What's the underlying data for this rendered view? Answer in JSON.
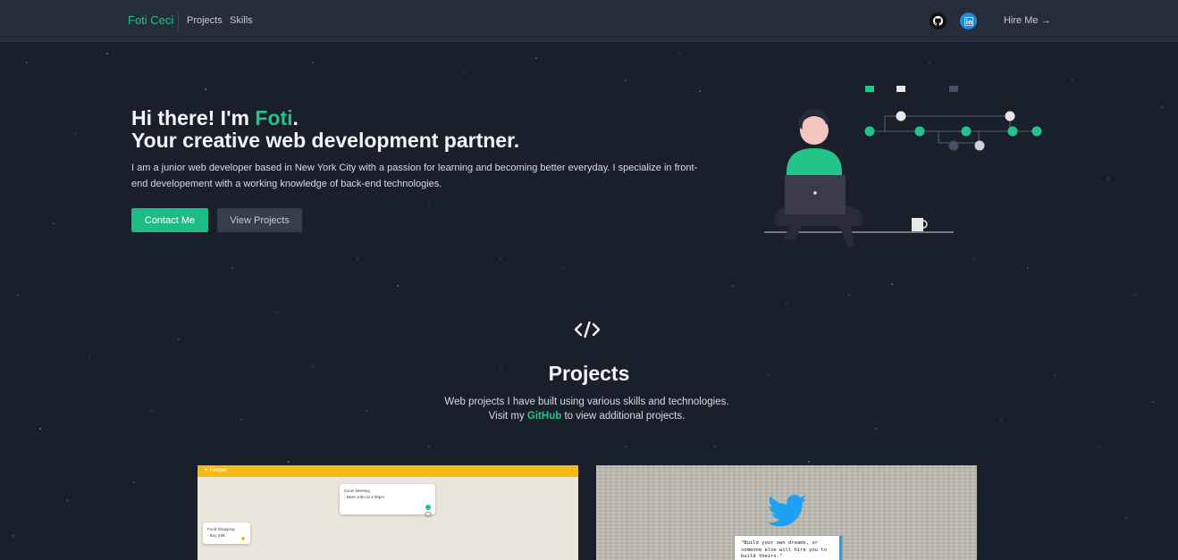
{
  "nav": {
    "brand": "Foti Ceci",
    "links": [
      "Projects",
      "Skills"
    ],
    "github_icon": "github-icon",
    "linkedin_icon": "linkedin-icon",
    "hire_label": "Hire Me",
    "hire_arrow": "→"
  },
  "hero": {
    "greeting_prefix": "Hi there! I'm ",
    "name": "Foti",
    "greeting_suffix": ".",
    "tagline": "Your creative web development partner.",
    "description": "I am a junior web developer based in New York City with a passion for learning and becoming better everyday. I specialize in front-end developement with a working knowledge of back-end technologies.",
    "contact_button": "Contact Me",
    "projects_button": "View Projects"
  },
  "projects": {
    "icon": "code-icon",
    "title": "Projects",
    "subtitle_line1": "Web projects I have built using various skills and technologies.",
    "subtitle_prefix": "Visit my ",
    "github_link": "GitHub",
    "subtitle_suffix": " to view additional projects.",
    "keeper": {
      "app_name": "✦ Keeper",
      "note1_title": "Zoom Meeting",
      "note1_body": "- Meet John at 4:30pm",
      "note2_title": "Food Shopping",
      "note2_body": "- Buy milk"
    },
    "twitter": {
      "icon": "twitter-bird-icon",
      "quote": "\"Build your own dreams, or someone else will hire you to build theirs.\""
    }
  },
  "colors": {
    "accent": "#23c48a",
    "background": "#1a1f2c",
    "navbar": "#262c3a",
    "linkedin": "#1e88d8",
    "keeper_yellow": "#f5ba13",
    "twitter_blue": "#1da1f2"
  }
}
